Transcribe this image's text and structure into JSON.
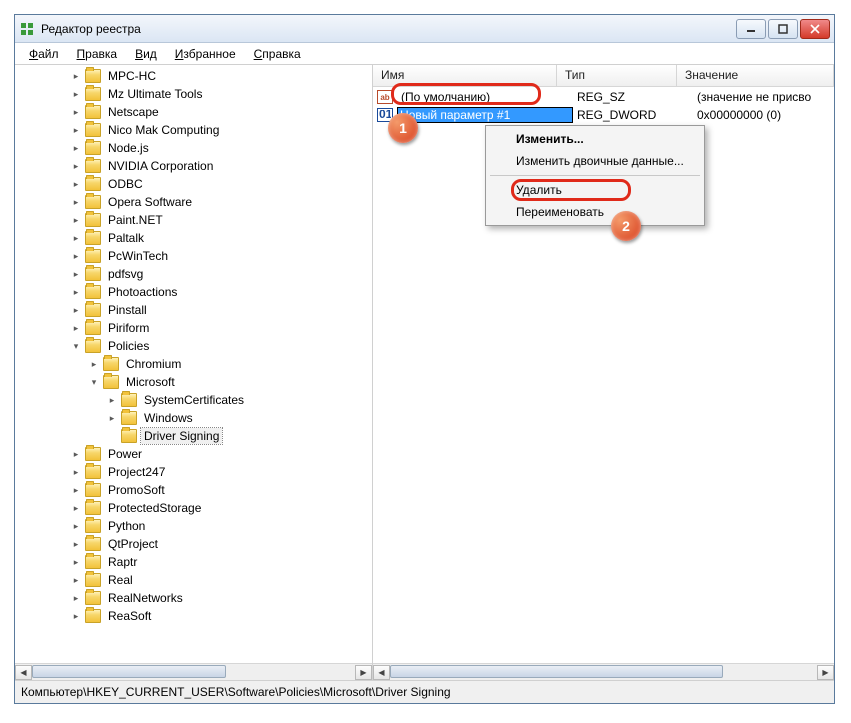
{
  "window": {
    "title": "Редактор реестра"
  },
  "menubar": [
    "Файл",
    "Правка",
    "Вид",
    "Избранное",
    "Справка"
  ],
  "tree": [
    {
      "depth": 3,
      "exp": "closed",
      "label": "MPC-HC"
    },
    {
      "depth": 3,
      "exp": "closed",
      "label": "Mz Ultimate Tools"
    },
    {
      "depth": 3,
      "exp": "closed",
      "label": "Netscape"
    },
    {
      "depth": 3,
      "exp": "closed",
      "label": "Nico Mak Computing"
    },
    {
      "depth": 3,
      "exp": "closed",
      "label": "Node.js"
    },
    {
      "depth": 3,
      "exp": "closed",
      "label": "NVIDIA Corporation"
    },
    {
      "depth": 3,
      "exp": "closed",
      "label": "ODBC"
    },
    {
      "depth": 3,
      "exp": "closed",
      "label": "Opera Software"
    },
    {
      "depth": 3,
      "exp": "closed",
      "label": "Paint.NET"
    },
    {
      "depth": 3,
      "exp": "closed",
      "label": "Paltalk"
    },
    {
      "depth": 3,
      "exp": "closed",
      "label": "PcWinTech"
    },
    {
      "depth": 3,
      "exp": "closed",
      "label": "pdfsvg"
    },
    {
      "depth": 3,
      "exp": "closed",
      "label": "Photoactions"
    },
    {
      "depth": 3,
      "exp": "closed",
      "label": "Pinstall"
    },
    {
      "depth": 3,
      "exp": "closed",
      "label": "Piriform"
    },
    {
      "depth": 3,
      "exp": "open",
      "label": "Policies"
    },
    {
      "depth": 4,
      "exp": "closed",
      "label": "Chromium"
    },
    {
      "depth": 4,
      "exp": "open",
      "label": "Microsoft"
    },
    {
      "depth": 5,
      "exp": "closed",
      "label": "SystemCertificates"
    },
    {
      "depth": 5,
      "exp": "closed",
      "label": "Windows"
    },
    {
      "depth": 5,
      "exp": "none",
      "label": "Driver Signing",
      "selected": true
    },
    {
      "depth": 3,
      "exp": "closed",
      "label": "Power"
    },
    {
      "depth": 3,
      "exp": "closed",
      "label": "Project247"
    },
    {
      "depth": 3,
      "exp": "closed",
      "label": "PromoSoft"
    },
    {
      "depth": 3,
      "exp": "closed",
      "label": "ProtectedStorage"
    },
    {
      "depth": 3,
      "exp": "closed",
      "label": "Python"
    },
    {
      "depth": 3,
      "exp": "closed",
      "label": "QtProject"
    },
    {
      "depth": 3,
      "exp": "closed",
      "label": "Raptr"
    },
    {
      "depth": 3,
      "exp": "closed",
      "label": "Real"
    },
    {
      "depth": 3,
      "exp": "closed",
      "label": "RealNetworks"
    },
    {
      "depth": 3,
      "exp": "closed",
      "label": "ReaSoft"
    }
  ],
  "columns": {
    "name": "Имя",
    "type": "Тип",
    "value": "Значение"
  },
  "values": [
    {
      "icon": "sz",
      "name": "(По умолчанию)",
      "type": "REG_SZ",
      "data": "(значение не присво"
    },
    {
      "icon": "dword",
      "name": "Новый параметр #1",
      "type": "REG_DWORD",
      "data": "0x00000000 (0)",
      "editing": true
    }
  ],
  "context_menu": {
    "edit": "Изменить...",
    "edit_binary": "Изменить двоичные данные...",
    "delete": "Удалить",
    "rename": "Переименовать"
  },
  "annotations": {
    "b1": "1",
    "b2": "2"
  },
  "statusbar": "Компьютер\\HKEY_CURRENT_USER\\Software\\Policies\\Microsoft\\Driver Signing"
}
